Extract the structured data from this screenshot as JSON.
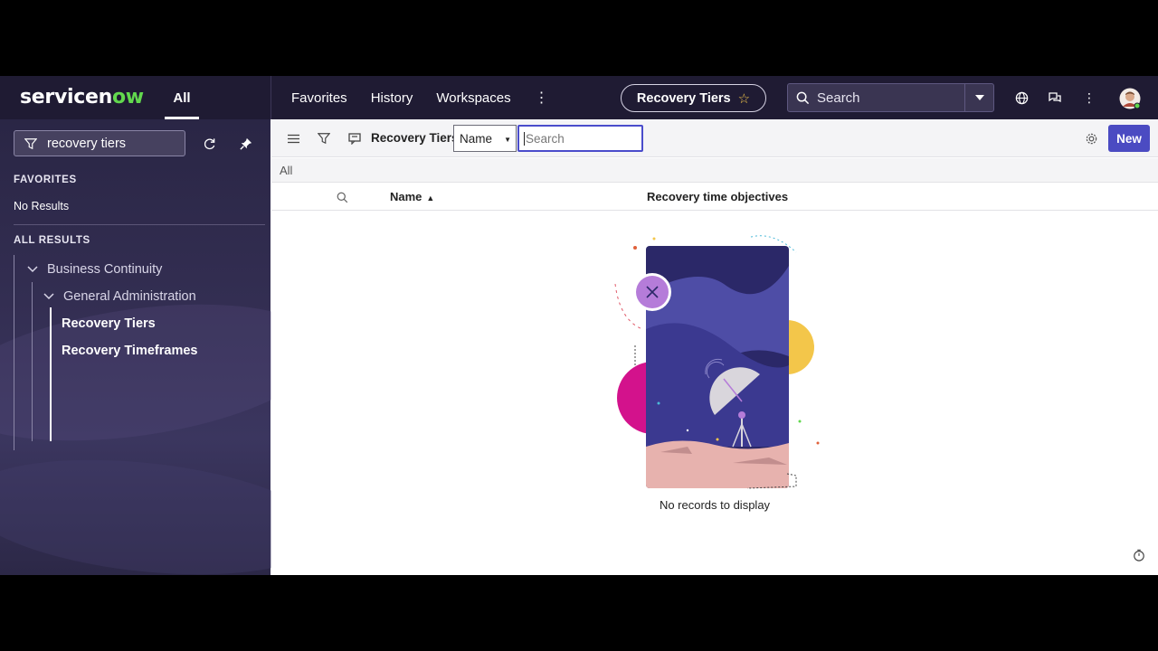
{
  "header": {
    "logo_pre": "servicen",
    "logo_ow": "ow",
    "all_tab": "All",
    "nav": [
      "Favorites",
      "History",
      "Workspaces"
    ],
    "context_title": "Recovery Tiers",
    "search_label": "Search"
  },
  "sidebar": {
    "filter_value": "recovery tiers",
    "favorites_heading": "FAVORITES",
    "favorites_empty": "No Results",
    "all_results_heading": "ALL RESULTS",
    "tree": {
      "level1": "Business Continuity",
      "level2": "General Administration",
      "leaves": [
        "Recovery Tiers",
        "Recovery Timeframes"
      ]
    }
  },
  "list": {
    "title": "Recovery Tiers",
    "field_select": "Name",
    "search_placeholder": "Search",
    "new_label": "New",
    "breadcrumb": "All",
    "columns": [
      "Name",
      "Recovery time objectives"
    ],
    "empty_message": "No records to display"
  },
  "colors": {
    "header_bg": "#1f1b33",
    "accent": "#4b4bc2",
    "logo_green": "#62d84e"
  }
}
